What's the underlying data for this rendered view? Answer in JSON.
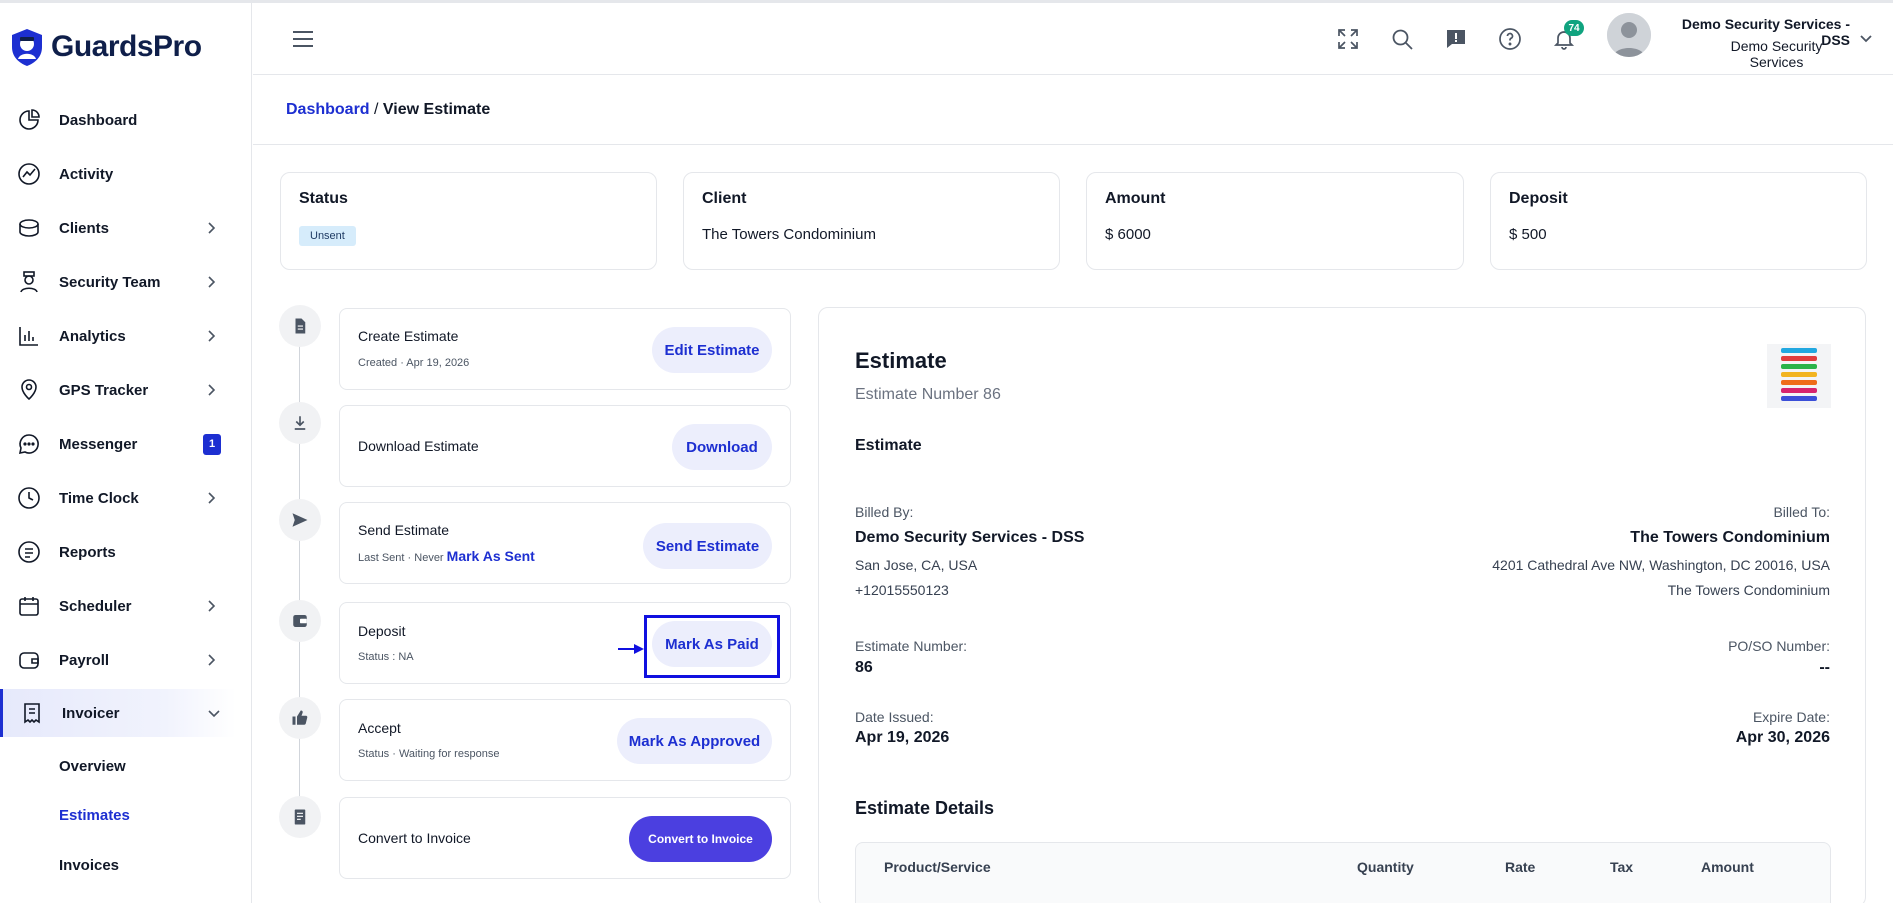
{
  "brand": {
    "name": "GuardsPro"
  },
  "sidebar": {
    "items": [
      {
        "label": "Dashboard",
        "icon": "pie-chart-icon",
        "has_chevron": false
      },
      {
        "label": "Activity",
        "icon": "activity-icon",
        "has_chevron": false
      },
      {
        "label": "Clients",
        "icon": "briefcase-icon",
        "has_chevron": true
      },
      {
        "label": "Security Team",
        "icon": "guard-icon",
        "has_chevron": true
      },
      {
        "label": "Analytics",
        "icon": "bar-chart-icon",
        "has_chevron": true
      },
      {
        "label": "GPS Tracker",
        "icon": "location-pin-icon",
        "has_chevron": true
      },
      {
        "label": "Messenger",
        "icon": "chat-icon",
        "badge": "1"
      },
      {
        "label": "Time Clock",
        "icon": "clock-icon",
        "has_chevron": true
      },
      {
        "label": "Reports",
        "icon": "report-icon",
        "has_chevron": false
      },
      {
        "label": "Scheduler",
        "icon": "calendar-icon",
        "has_chevron": true
      },
      {
        "label": "Payroll",
        "icon": "wallet-icon",
        "has_chevron": true
      },
      {
        "label": "Invoicer",
        "icon": "invoice-icon",
        "expanded": true
      }
    ],
    "subitems": [
      {
        "label": "Overview"
      },
      {
        "label": "Estimates",
        "current": true
      },
      {
        "label": "Invoices"
      }
    ]
  },
  "header": {
    "notification_count": "74",
    "user_name": "Demo Security Services - DSS",
    "user_org": "Demo Security Services"
  },
  "breadcrumb": {
    "root": "Dashboard",
    "separator": " / ",
    "current": "View Estimate"
  },
  "summary": {
    "status": {
      "title": "Status",
      "value": "Unsent"
    },
    "client": {
      "title": "Client",
      "value": "The Towers Condominium"
    },
    "amount": {
      "title": "Amount",
      "value": "$ 6000"
    },
    "deposit": {
      "title": "Deposit",
      "value": "$ 500"
    }
  },
  "steps": [
    {
      "title": "Create Estimate",
      "subtitle": "Created · Apr 19, 2026",
      "button": "Edit Estimate",
      "icon": "document-icon"
    },
    {
      "title": "Download Estimate",
      "subtitle": "",
      "button": "Download",
      "icon": "download-icon"
    },
    {
      "title": "Send Estimate",
      "subtitle": "Last Sent · Never",
      "link": "Mark As Sent",
      "button": "Send Estimate",
      "icon": "send-icon"
    },
    {
      "title": "Deposit",
      "subtitle": "Status : NA",
      "button": "Mark As Paid",
      "icon": "wallet-icon"
    },
    {
      "title": "Accept",
      "subtitle": "Status · Waiting for response",
      "button": "Mark As Approved",
      "icon": "thumbs-up-icon"
    },
    {
      "title": "Convert to Invoice",
      "subtitle": "",
      "button": "Convert to Invoice",
      "icon": "invoice-icon"
    }
  ],
  "estimate": {
    "title": "Estimate",
    "number_line": "Estimate Number 86",
    "subtitle": "Estimate",
    "billed_by_label": "Billed By:",
    "billed_by_name": "Demo Security Services - DSS",
    "billed_by_address": "San Jose, CA, USA",
    "billed_by_phone": "+12015550123",
    "billed_to_label": "Billed To:",
    "billed_to_name": "The Towers Condominium",
    "billed_to_address": "4201 Cathedral Ave NW, Washington, DC 20016, USA",
    "billed_to_extra": "The Towers Condominium",
    "number_label": "Estimate Number:",
    "number_value": "86",
    "po_label": "PO/SO Number:",
    "po_value": "--",
    "issued_label": "Date Issued:",
    "issued_value": "Apr 19, 2026",
    "expire_label": "Expire Date:",
    "expire_value": "Apr 30, 2026",
    "details_title": "Estimate Details",
    "table_headers": [
      "Product/Service",
      "Quantity",
      "Rate",
      "Tax",
      "Amount"
    ]
  }
}
